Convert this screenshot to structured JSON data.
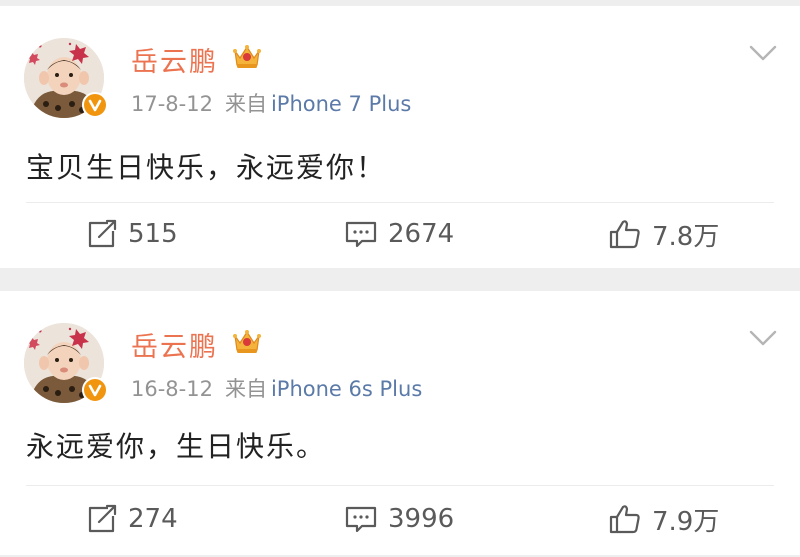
{
  "posts": [
    {
      "username": "岳云鹏",
      "date": "17-8-12",
      "source_prefix": "来自",
      "device": "iPhone 7 Plus",
      "text": "宝贝生日快乐，永远爱你！",
      "reposts": "515",
      "comments": "2674",
      "likes": "7.8万"
    },
    {
      "username": "岳云鹏",
      "date": "16-8-12",
      "source_prefix": "来自",
      "device": "iPhone 6s Plus",
      "text": "永远爱你，生日快乐。",
      "reposts": "274",
      "comments": "3996",
      "likes": "7.9万"
    }
  ],
  "icons": {
    "avatar": "baby-avatar",
    "badge": "verified-v-icon",
    "vip": "crown-icon",
    "menu": "chevron-down-icon",
    "repost": "repost-icon",
    "comment": "comment-icon",
    "like": "thumbs-up-icon"
  },
  "colors": {
    "username": "#eb7350",
    "device_link": "#5b7aa8",
    "badge": "#f1950f"
  }
}
